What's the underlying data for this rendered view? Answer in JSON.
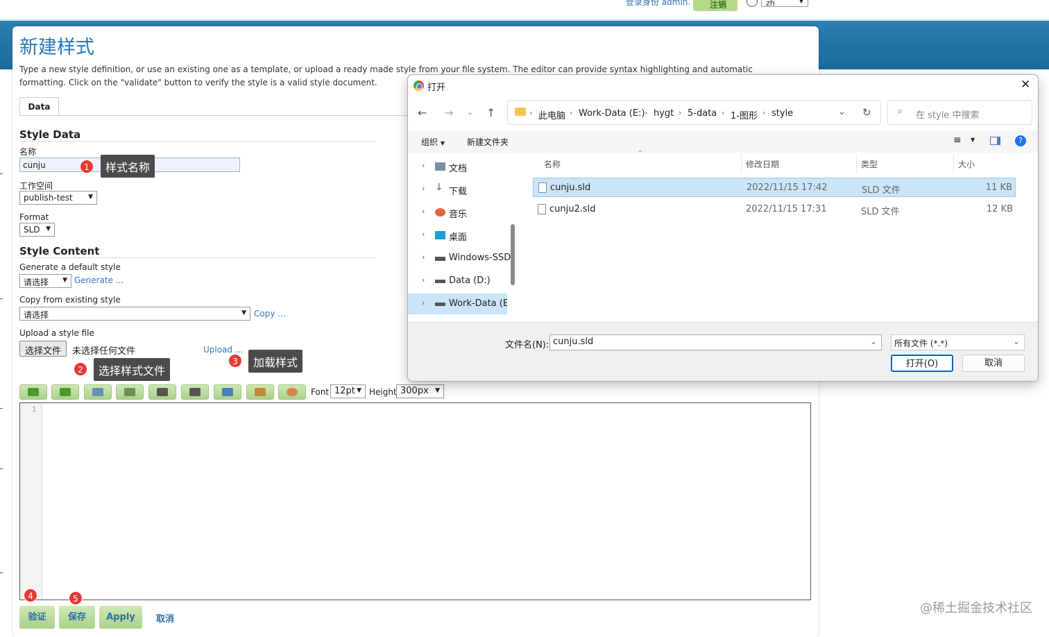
{
  "header": {
    "login_text": "登录身份 admin.",
    "logout_label": "注销",
    "language": "zh"
  },
  "page": {
    "title": "新建样式",
    "description": "Type a new style definition, or use an existing one as a template, or upload a ready made style from your file system. The editor can provide syntax highlighting and automatic formatting. Click on the \"validate\" button to verify the style is a valid style document.",
    "tab_data": "Data"
  },
  "style_data": {
    "heading": "Style Data",
    "name_label": "名称",
    "name_value": "cunju",
    "workspace_label": "工作空间",
    "workspace_value": "publish-test",
    "format_label": "Format",
    "format_value": "SLD"
  },
  "style_content": {
    "heading": "Style Content",
    "generate_label": "Generate a default style",
    "generate_select": "请选择",
    "generate_link": "Generate ...",
    "copy_label": "Copy from existing style",
    "copy_select": "请选择",
    "copy_link": "Copy ...",
    "upload_label": "Upload a style file",
    "choose_file_button": "选择文件",
    "no_file_text": "未选择任何文件",
    "upload_link": "Upload ..."
  },
  "editor_toolbar": {
    "font_label": "Font",
    "font_value": "12pt",
    "height_label": "Height",
    "height_value": "300px",
    "line_number": "1"
  },
  "actions": {
    "validate": "验证",
    "save": "保存",
    "apply": "Apply",
    "cancel": "取消"
  },
  "annotations": {
    "badge1": "1",
    "callout1": "样式名称",
    "badge2": "2",
    "callout2": "选择样式文件",
    "badge3": "3",
    "callout3": "加载样式",
    "badge4": "4",
    "badge5": "5"
  },
  "watermark": "@稀土掘金技术社区",
  "dialog": {
    "title": "打开",
    "breadcrumb": [
      "此电脑",
      "Work-Data (E:)",
      "hygt",
      "5-data",
      "1-图形",
      "style"
    ],
    "search_placeholder": "在 style 中搜索",
    "organize": "组织",
    "new_folder": "新建文件夹",
    "nav_items": [
      {
        "label": "文档",
        "icon": "documents-icon"
      },
      {
        "label": "下载",
        "icon": "download-icon"
      },
      {
        "label": "音乐",
        "icon": "music-icon"
      },
      {
        "label": "桌面",
        "icon": "desktop-icon"
      },
      {
        "label": "Windows-SSD",
        "icon": "drive-icon"
      },
      {
        "label": "Data (D:)",
        "icon": "drive-icon"
      },
      {
        "label": "Work-Data (E:)",
        "icon": "drive-icon"
      }
    ],
    "columns": {
      "name": "名称",
      "modified": "修改日期",
      "type": "类型",
      "size": "大小"
    },
    "files": [
      {
        "name": "cunju.sld",
        "modified": "2022/11/15 17:42",
        "type": "SLD 文件",
        "size": "11 KB",
        "selected": true
      },
      {
        "name": "cunju2.sld",
        "modified": "2022/11/15 17:31",
        "type": "SLD 文件",
        "size": "12 KB",
        "selected": false
      }
    ],
    "filename_label": "文件名(N):",
    "filename_value": "cunju.sld",
    "filetype_value": "所有文件 (*.*)",
    "open_button": "打开(O)",
    "cancel_button": "取消"
  }
}
